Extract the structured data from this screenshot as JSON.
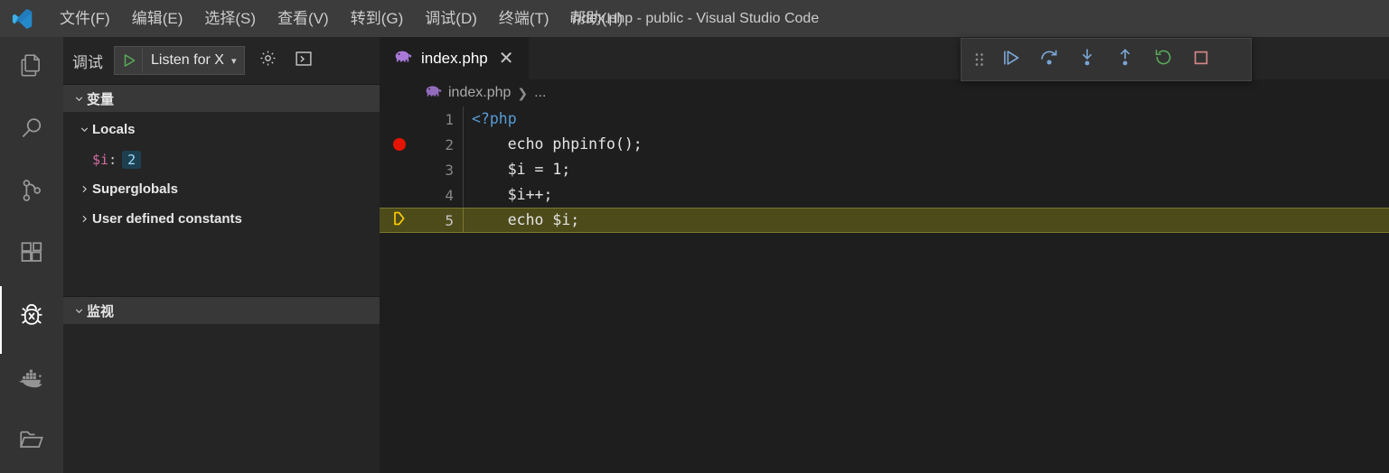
{
  "window": {
    "title": "index.php - public - Visual Studio Code",
    "logo_icon": "vscode-logo-icon"
  },
  "menubar": {
    "items": [
      {
        "label": "文件(F)",
        "name": "menu-file"
      },
      {
        "label": "编辑(E)",
        "name": "menu-edit"
      },
      {
        "label": "选择(S)",
        "name": "menu-selection"
      },
      {
        "label": "查看(V)",
        "name": "menu-view"
      },
      {
        "label": "转到(G)",
        "name": "menu-go"
      },
      {
        "label": "调试(D)",
        "name": "menu-debug"
      },
      {
        "label": "终端(T)",
        "name": "menu-terminal"
      },
      {
        "label": "帮助(H)",
        "name": "menu-help"
      }
    ]
  },
  "activitybar": {
    "items": [
      {
        "icon": "files-explorer-icon",
        "active": false
      },
      {
        "icon": "search-icon",
        "active": false
      },
      {
        "icon": "source-control-icon",
        "active": false
      },
      {
        "icon": "extensions-icon",
        "active": false
      },
      {
        "icon": "debug-bug-icon",
        "active": true
      },
      {
        "icon": "docker-whale-icon",
        "active": false
      },
      {
        "icon": "folder-icon",
        "active": false
      }
    ]
  },
  "sidebar": {
    "debug_label": "调试",
    "configuration": "Listen for X",
    "start_icon": "green-play-icon",
    "dropdown_caret": "▾",
    "settings_icon": "gear-icon",
    "console_icon": "open-debug-console-icon",
    "variables": {
      "title": "变量",
      "expanded": true,
      "nodes": [
        {
          "label": "Locals",
          "expanded": true,
          "type": "scope"
        },
        {
          "name": "$i",
          "value": "2",
          "type": "variable"
        },
        {
          "label": "Superglobals",
          "expanded": false,
          "type": "scope"
        },
        {
          "label": "User defined constants",
          "expanded": false,
          "type": "scope"
        }
      ]
    },
    "watch": {
      "title": "监视",
      "expanded": true
    }
  },
  "editor": {
    "tab": {
      "label": "index.php",
      "file_icon": "php-elephant-icon",
      "close_icon": "close-icon"
    },
    "breadcrumb": {
      "file": "index.php",
      "separator": "❯",
      "more": "..."
    },
    "lines": [
      {
        "number": "1",
        "text": "<?php",
        "token": "tag",
        "breakpoint": false,
        "current": false
      },
      {
        "number": "2",
        "text": "    echo phpinfo();",
        "token": "plain",
        "breakpoint": true,
        "current": false
      },
      {
        "number": "3",
        "text": "    $i = 1;",
        "token": "plain",
        "breakpoint": false,
        "current": false
      },
      {
        "number": "4",
        "text": "    $i++;",
        "token": "plain",
        "breakpoint": false,
        "current": false
      },
      {
        "number": "5",
        "text": "    echo $i;",
        "token": "plain",
        "breakpoint": false,
        "current": true
      }
    ]
  },
  "debug_toolbar": {
    "buttons": [
      {
        "icon": "drag-handle-icon",
        "name": "debug-toolbar-drag-handle"
      },
      {
        "icon": "continue-icon",
        "name": "debug-continue-button"
      },
      {
        "icon": "step-over-icon",
        "name": "debug-step-over-button"
      },
      {
        "icon": "step-into-icon",
        "name": "debug-step-into-button"
      },
      {
        "icon": "step-out-icon",
        "name": "debug-step-out-button"
      },
      {
        "icon": "restart-icon",
        "name": "debug-restart-button"
      },
      {
        "icon": "stop-icon",
        "name": "debug-stop-button"
      }
    ]
  },
  "colors": {
    "titlebar_bg": "#3c3c3c",
    "activitybar_bg": "#333333",
    "sidebar_bg": "#252526",
    "editor_bg": "#1e1e1e",
    "breakpoint_red": "#e51400",
    "current_line_bg": "#4d4b1a",
    "debug_arrow_yellow": "#ffcc00",
    "play_green": "#5aab5a",
    "stop_red": "#d48787",
    "restart_green": "#5aab5a",
    "step_blue": "#7aa6d6",
    "var_name_pink": "#d16d9e",
    "var_value_blue": "#9cdcfe",
    "php_purple": "#a879d9"
  }
}
